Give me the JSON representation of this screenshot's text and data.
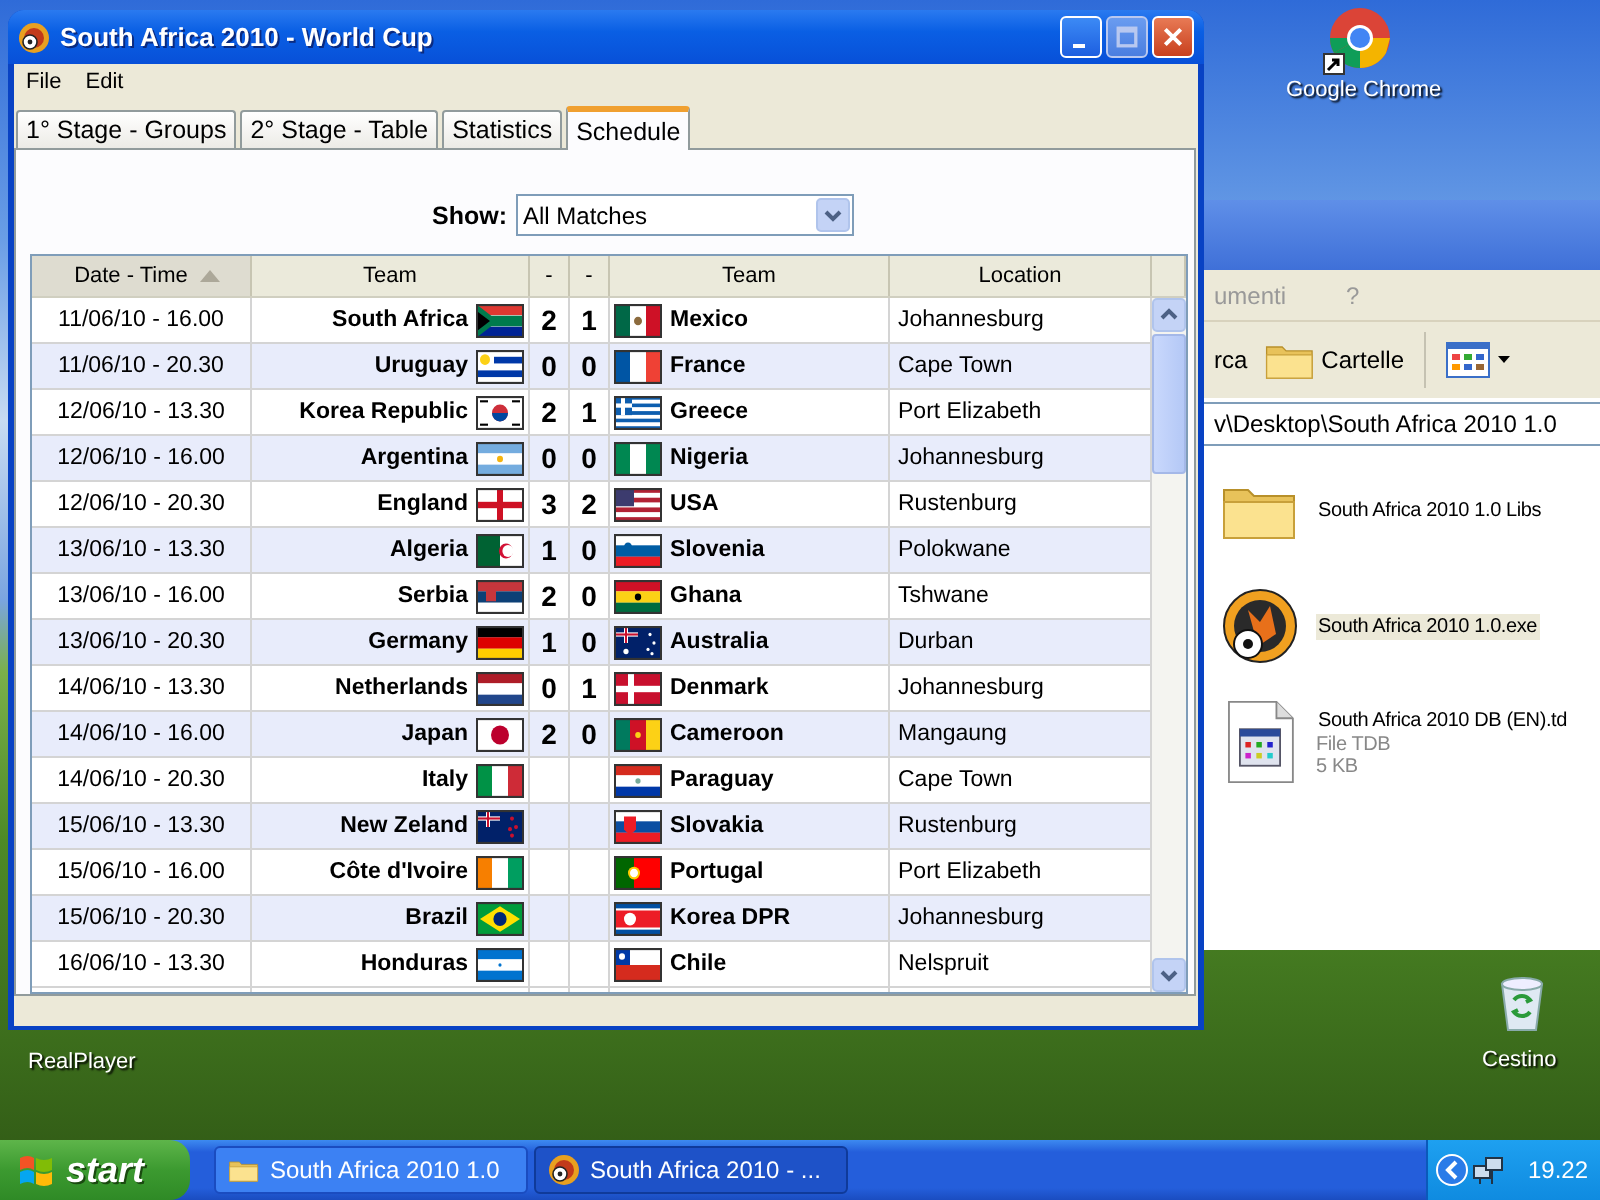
{
  "desktop_icons": [
    {
      "label": "Google Chrome"
    },
    {
      "label": "RealPlayer"
    },
    {
      "label": "Cestino"
    }
  ],
  "explorer_window": {
    "menu": [
      "umenti",
      "?"
    ],
    "toolbar": [
      "rca",
      "Cartelle"
    ],
    "address": "v\\Desktop\\South Africa 2010 1.0",
    "files": [
      {
        "kind": "folder",
        "name": "South Africa 2010 1.0 Libs",
        "selected": false
      },
      {
        "kind": "app",
        "name": "South Africa 2010 1.0.exe",
        "selected": true
      },
      {
        "kind": "document",
        "name": "South Africa 2010 DB (EN).td",
        "type": "File TDB",
        "size": "5 KB",
        "selected": false
      }
    ]
  },
  "window": {
    "title": "South Africa 2010 - World Cup"
  },
  "menu": [
    "File",
    "Edit"
  ],
  "tabs": [
    {
      "label": "1° Stage - Groups",
      "selected": false
    },
    {
      "label": "2° Stage - Table",
      "selected": false
    },
    {
      "label": "Statistics",
      "selected": false
    },
    {
      "label": "Schedule",
      "selected": true
    }
  ],
  "filter": {
    "label": "Show:",
    "value": "All Matches"
  },
  "table": {
    "columns": [
      {
        "label": "Date - Time",
        "sorted": true
      },
      {
        "label": "Team",
        "sorted": false
      },
      {
        "label": "-",
        "sorted": false
      },
      {
        "label": "-",
        "sorted": false
      },
      {
        "label": "Team",
        "sorted": false
      },
      {
        "label": "Location",
        "sorted": false
      }
    ],
    "rows": [
      {
        "date": "11/06/10 - 16.00",
        "home": "South Africa",
        "home_score": "2",
        "away_score": "1",
        "away": "Mexico",
        "location": "Johannesburg"
      },
      {
        "date": "11/06/10 - 20.30",
        "home": "Uruguay",
        "home_score": "0",
        "away_score": "0",
        "away": "France",
        "location": "Cape Town"
      },
      {
        "date": "12/06/10 - 13.30",
        "home": "Korea Republic",
        "home_score": "2",
        "away_score": "1",
        "away": "Greece",
        "location": "Port Elizabeth"
      },
      {
        "date": "12/06/10 - 16.00",
        "home": "Argentina",
        "home_score": "0",
        "away_score": "0",
        "away": "Nigeria",
        "location": "Johannesburg"
      },
      {
        "date": "12/06/10 - 20.30",
        "home": "England",
        "home_score": "3",
        "away_score": "2",
        "away": "USA",
        "location": "Rustenburg"
      },
      {
        "date": "13/06/10 - 13.30",
        "home": "Algeria",
        "home_score": "1",
        "away_score": "0",
        "away": "Slovenia",
        "location": "Polokwane"
      },
      {
        "date": "13/06/10 - 16.00",
        "home": "Serbia",
        "home_score": "2",
        "away_score": "0",
        "away": "Ghana",
        "location": "Tshwane"
      },
      {
        "date": "13/06/10 - 20.30",
        "home": "Germany",
        "home_score": "1",
        "away_score": "0",
        "away": "Australia",
        "location": "Durban"
      },
      {
        "date": "14/06/10 - 13.30",
        "home": "Netherlands",
        "home_score": "0",
        "away_score": "1",
        "away": "Denmark",
        "location": "Johannesburg"
      },
      {
        "date": "14/06/10 - 16.00",
        "home": "Japan",
        "home_score": "2",
        "away_score": "0",
        "away": "Cameroon",
        "location": "Mangaung"
      },
      {
        "date": "14/06/10 - 20.30",
        "home": "Italy",
        "away": "Paraguay",
        "location": "Cape Town"
      },
      {
        "date": "15/06/10 - 13.30",
        "home": "New Zeland",
        "away": "Slovakia",
        "location": "Rustenburg"
      },
      {
        "date": "15/06/10 - 16.00",
        "home": "Côte d'Ivoire",
        "away": "Portugal",
        "location": "Port Elizabeth"
      },
      {
        "date": "15/06/10 - 20.30",
        "home": "Brazil",
        "away": "Korea DPR",
        "location": "Johannesburg"
      },
      {
        "date": "16/06/10 - 13.30",
        "home": "Honduras",
        "away": "Chile",
        "location": "Nelspruit"
      }
    ]
  },
  "taskbar": {
    "start": "start",
    "tasks": [
      {
        "kind": "folder",
        "label": "South Africa 2010 1.0",
        "selected": false
      },
      {
        "kind": "app",
        "label": "South Africa 2010 - ...",
        "selected": true
      }
    ],
    "clock": "19.22"
  }
}
